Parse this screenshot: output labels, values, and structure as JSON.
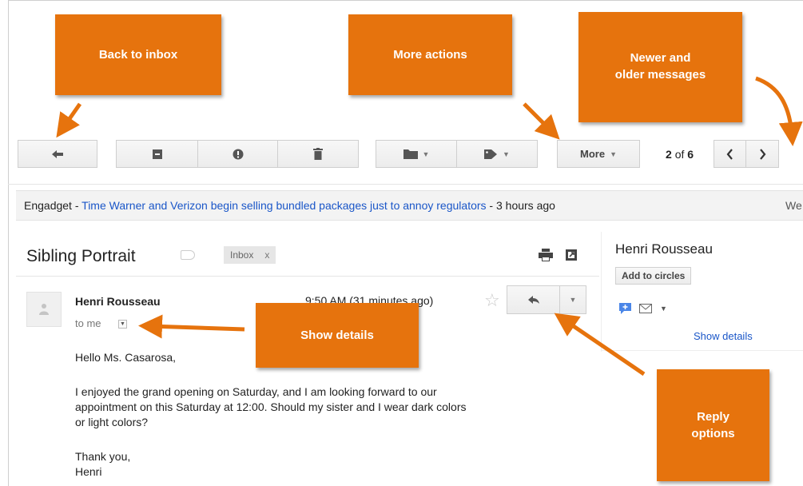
{
  "toolbar": {
    "more_label": "More",
    "pager_current": "2",
    "pager_sep": "of",
    "pager_total": "6"
  },
  "news": {
    "source": "Engadget",
    "sep1": " - ",
    "headline": "Time Warner and Verizon begin selling bundled packages just to annoy regulators",
    "sep2": " - ",
    "age": "3 hours ago",
    "clipped": "We"
  },
  "message": {
    "subject": "Sibling Portrait",
    "label": "Inbox",
    "label_remove": "x",
    "sender": "Henri Rousseau",
    "to": "to me",
    "time": "9:50 AM (31 minutes ago)",
    "greeting": "Hello Ms. Casarosa,",
    "paragraph_line1": "I enjoyed the grand opening on Saturday, and I am looking forward to our",
    "paragraph_line2": "appointment on this Saturday at 12:00. Should my sister and I wear dark colors",
    "paragraph_line3": "or light colors?",
    "signoff": "Thank you,",
    "signature": "Henri"
  },
  "contact_panel": {
    "name": "Henri Rousseau",
    "add_button": "Add to circles",
    "show_details": "Show details"
  },
  "callouts": {
    "back": "Back to inbox",
    "more": "More actions",
    "newer_line1": "Newer and",
    "newer_line2": "older messages",
    "show_details": "Show details",
    "reply_line1": "Reply",
    "reply_line2": "options"
  },
  "colors": {
    "callout": "#e6730d",
    "link": "#1a56c8"
  }
}
